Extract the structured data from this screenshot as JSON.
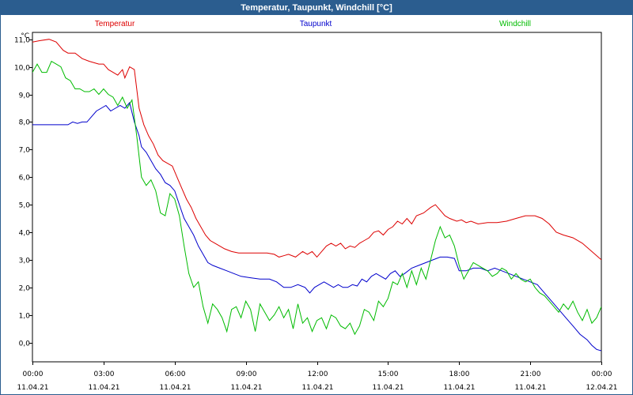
{
  "window": {
    "title": "Temperatur, Taupunkt, Windchill [°C]"
  },
  "chart_data": {
    "type": "line",
    "title": "Temperatur, Taupunkt, Windchill [°C]",
    "ylabel": "°C",
    "xlabel": "",
    "ylim": [
      -0.7,
      11.25
    ],
    "xlim": [
      0,
      24
    ],
    "grid": true,
    "yticks": [
      "0,0",
      "1,0",
      "2,0",
      "3,0",
      "4,0",
      "5,0",
      "6,0",
      "7,0",
      "8,0",
      "9,0",
      "10,0",
      "11,0"
    ],
    "ytick_values": [
      0,
      1,
      2,
      3,
      4,
      5,
      6,
      7,
      8,
      9,
      10,
      11
    ],
    "xtick_values": [
      0,
      3,
      6,
      9,
      12,
      15,
      18,
      21,
      24
    ],
    "xticks_time": [
      "00:00",
      "03:00",
      "06:00",
      "09:00",
      "12:00",
      "15:00",
      "18:00",
      "21:00",
      "00:00"
    ],
    "xticks_date": [
      "11.04.21",
      "11.04.21",
      "11.04.21",
      "11.04.21",
      "11.04.21",
      "11.04.21",
      "11.04.21",
      "11.04.21",
      "12.04.21"
    ],
    "series": [
      {
        "name": "Temperatur",
        "color": "#dd0000",
        "points": [
          [
            0,
            10.9
          ],
          [
            0.3,
            10.95
          ],
          [
            0.7,
            11.0
          ],
          [
            1,
            10.9
          ],
          [
            1.3,
            10.6
          ],
          [
            1.5,
            10.5
          ],
          [
            1.8,
            10.5
          ],
          [
            2.1,
            10.3
          ],
          [
            2.4,
            10.2
          ],
          [
            2.8,
            10.1
          ],
          [
            3.0,
            10.1
          ],
          [
            3.2,
            9.9
          ],
          [
            3.4,
            9.8
          ],
          [
            3.6,
            9.7
          ],
          [
            3.8,
            9.9
          ],
          [
            3.9,
            9.6
          ],
          [
            4.1,
            10.0
          ],
          [
            4.3,
            9.9
          ],
          [
            4.5,
            8.5
          ],
          [
            4.7,
            7.9
          ],
          [
            4.9,
            7.5
          ],
          [
            5.1,
            7.2
          ],
          [
            5.3,
            6.8
          ],
          [
            5.5,
            6.6
          ],
          [
            5.7,
            6.5
          ],
          [
            5.9,
            6.4
          ],
          [
            6.1,
            6.0
          ],
          [
            6.3,
            5.6
          ],
          [
            6.5,
            5.2
          ],
          [
            6.7,
            4.9
          ],
          [
            6.9,
            4.5
          ],
          [
            7.1,
            4.2
          ],
          [
            7.3,
            3.9
          ],
          [
            7.5,
            3.7
          ],
          [
            7.7,
            3.6
          ],
          [
            7.9,
            3.5
          ],
          [
            8.1,
            3.4
          ],
          [
            8.4,
            3.3
          ],
          [
            8.7,
            3.25
          ],
          [
            9.0,
            3.25
          ],
          [
            9.5,
            3.25
          ],
          [
            9.9,
            3.25
          ],
          [
            10.2,
            3.2
          ],
          [
            10.4,
            3.1
          ],
          [
            10.6,
            3.15
          ],
          [
            10.8,
            3.2
          ],
          [
            11.1,
            3.1
          ],
          [
            11.4,
            3.3
          ],
          [
            11.6,
            3.2
          ],
          [
            11.8,
            3.3
          ],
          [
            12.0,
            3.1
          ],
          [
            12.2,
            3.3
          ],
          [
            12.4,
            3.5
          ],
          [
            12.6,
            3.6
          ],
          [
            12.8,
            3.5
          ],
          [
            13.0,
            3.6
          ],
          [
            13.2,
            3.4
          ],
          [
            13.4,
            3.5
          ],
          [
            13.6,
            3.45
          ],
          [
            13.8,
            3.6
          ],
          [
            14.0,
            3.7
          ],
          [
            14.2,
            3.8
          ],
          [
            14.4,
            4.0
          ],
          [
            14.6,
            4.05
          ],
          [
            14.8,
            3.9
          ],
          [
            15.0,
            4.1
          ],
          [
            15.2,
            4.2
          ],
          [
            15.4,
            4.4
          ],
          [
            15.6,
            4.3
          ],
          [
            15.8,
            4.5
          ],
          [
            16.0,
            4.3
          ],
          [
            16.2,
            4.6
          ],
          [
            16.5,
            4.7
          ],
          [
            16.8,
            4.9
          ],
          [
            17.0,
            5.0
          ],
          [
            17.2,
            4.8
          ],
          [
            17.4,
            4.6
          ],
          [
            17.6,
            4.5
          ],
          [
            17.9,
            4.4
          ],
          [
            18.1,
            4.45
          ],
          [
            18.3,
            4.35
          ],
          [
            18.5,
            4.4
          ],
          [
            18.8,
            4.3
          ],
          [
            19.2,
            4.35
          ],
          [
            19.6,
            4.35
          ],
          [
            20.0,
            4.4
          ],
          [
            20.4,
            4.5
          ],
          [
            20.8,
            4.6
          ],
          [
            21.2,
            4.6
          ],
          [
            21.5,
            4.5
          ],
          [
            21.8,
            4.3
          ],
          [
            22.1,
            4.0
          ],
          [
            22.4,
            3.9
          ],
          [
            22.8,
            3.8
          ],
          [
            23.2,
            3.6
          ],
          [
            23.6,
            3.3
          ],
          [
            24.0,
            3.0
          ]
        ]
      },
      {
        "name": "Taupunkt",
        "color": "#0000cc",
        "points": [
          [
            0,
            7.9
          ],
          [
            0.5,
            7.9
          ],
          [
            1.0,
            7.9
          ],
          [
            1.5,
            7.9
          ],
          [
            1.7,
            8.0
          ],
          [
            1.9,
            7.95
          ],
          [
            2.1,
            8.0
          ],
          [
            2.3,
            8.0
          ],
          [
            2.5,
            8.2
          ],
          [
            2.7,
            8.4
          ],
          [
            2.9,
            8.5
          ],
          [
            3.1,
            8.6
          ],
          [
            3.3,
            8.4
          ],
          [
            3.5,
            8.5
          ],
          [
            3.7,
            8.6
          ],
          [
            3.9,
            8.5
          ],
          [
            4.1,
            8.7
          ],
          [
            4.3,
            8.0
          ],
          [
            4.5,
            7.5
          ],
          [
            4.6,
            7.1
          ],
          [
            4.8,
            6.9
          ],
          [
            5.0,
            6.6
          ],
          [
            5.2,
            6.3
          ],
          [
            5.4,
            6.1
          ],
          [
            5.6,
            5.8
          ],
          [
            5.8,
            5.7
          ],
          [
            6.0,
            5.5
          ],
          [
            6.2,
            5.0
          ],
          [
            6.4,
            4.5
          ],
          [
            6.6,
            4.2
          ],
          [
            6.8,
            3.9
          ],
          [
            7.0,
            3.5
          ],
          [
            7.2,
            3.2
          ],
          [
            7.4,
            2.9
          ],
          [
            7.6,
            2.8
          ],
          [
            7.9,
            2.7
          ],
          [
            8.2,
            2.6
          ],
          [
            8.5,
            2.5
          ],
          [
            8.8,
            2.4
          ],
          [
            9.2,
            2.35
          ],
          [
            9.6,
            2.3
          ],
          [
            10.0,
            2.3
          ],
          [
            10.3,
            2.2
          ],
          [
            10.6,
            2.0
          ],
          [
            10.9,
            2.0
          ],
          [
            11.2,
            2.1
          ],
          [
            11.5,
            2.0
          ],
          [
            11.7,
            1.8
          ],
          [
            11.9,
            2.0
          ],
          [
            12.1,
            2.1
          ],
          [
            12.3,
            2.2
          ],
          [
            12.5,
            2.1
          ],
          [
            12.7,
            2.0
          ],
          [
            12.9,
            2.1
          ],
          [
            13.1,
            2.0
          ],
          [
            13.3,
            2.0
          ],
          [
            13.5,
            2.1
          ],
          [
            13.7,
            2.05
          ],
          [
            13.9,
            2.3
          ],
          [
            14.1,
            2.2
          ],
          [
            14.3,
            2.4
          ],
          [
            14.5,
            2.5
          ],
          [
            14.7,
            2.4
          ],
          [
            14.9,
            2.3
          ],
          [
            15.1,
            2.5
          ],
          [
            15.3,
            2.6
          ],
          [
            15.5,
            2.4
          ],
          [
            15.7,
            2.5
          ],
          [
            16.0,
            2.7
          ],
          [
            16.3,
            2.8
          ],
          [
            16.6,
            2.9
          ],
          [
            16.9,
            3.0
          ],
          [
            17.2,
            3.1
          ],
          [
            17.5,
            3.1
          ],
          [
            17.8,
            3.05
          ],
          [
            18.0,
            2.6
          ],
          [
            18.3,
            2.6
          ],
          [
            18.6,
            2.7
          ],
          [
            18.9,
            2.7
          ],
          [
            19.2,
            2.6
          ],
          [
            19.5,
            2.7
          ],
          [
            19.8,
            2.6
          ],
          [
            20.1,
            2.5
          ],
          [
            20.4,
            2.4
          ],
          [
            20.7,
            2.3
          ],
          [
            21.0,
            2.2
          ],
          [
            21.3,
            2.1
          ],
          [
            21.6,
            1.8
          ],
          [
            21.9,
            1.5
          ],
          [
            22.2,
            1.2
          ],
          [
            22.5,
            0.9
          ],
          [
            22.8,
            0.6
          ],
          [
            23.1,
            0.3
          ],
          [
            23.4,
            0.1
          ],
          [
            23.6,
            -0.1
          ],
          [
            23.8,
            -0.25
          ],
          [
            24.0,
            -0.3
          ]
        ]
      },
      {
        "name": "Windchill",
        "color": "#00bb00",
        "points": [
          [
            0,
            9.8
          ],
          [
            0.2,
            10.1
          ],
          [
            0.4,
            9.8
          ],
          [
            0.6,
            9.8
          ],
          [
            0.8,
            10.2
          ],
          [
            1.0,
            10.1
          ],
          [
            1.2,
            10.0
          ],
          [
            1.4,
            9.6
          ],
          [
            1.6,
            9.5
          ],
          [
            1.8,
            9.2
          ],
          [
            2.0,
            9.2
          ],
          [
            2.2,
            9.1
          ],
          [
            2.4,
            9.1
          ],
          [
            2.6,
            9.2
          ],
          [
            2.8,
            9.0
          ],
          [
            3.0,
            9.2
          ],
          [
            3.2,
            9.0
          ],
          [
            3.4,
            8.9
          ],
          [
            3.6,
            8.6
          ],
          [
            3.8,
            8.9
          ],
          [
            4.0,
            8.5
          ],
          [
            4.2,
            8.8
          ],
          [
            4.4,
            7.5
          ],
          [
            4.6,
            6.0
          ],
          [
            4.8,
            5.7
          ],
          [
            5.0,
            5.9
          ],
          [
            5.2,
            5.5
          ],
          [
            5.4,
            4.7
          ],
          [
            5.6,
            4.6
          ],
          [
            5.8,
            5.4
          ],
          [
            6.0,
            5.2
          ],
          [
            6.2,
            4.6
          ],
          [
            6.4,
            3.5
          ],
          [
            6.6,
            2.5
          ],
          [
            6.8,
            2.0
          ],
          [
            7.0,
            2.2
          ],
          [
            7.2,
            1.3
          ],
          [
            7.4,
            0.7
          ],
          [
            7.6,
            1.4
          ],
          [
            7.8,
            1.2
          ],
          [
            8.0,
            0.9
          ],
          [
            8.2,
            0.4
          ],
          [
            8.4,
            1.2
          ],
          [
            8.6,
            1.3
          ],
          [
            8.8,
            0.9
          ],
          [
            9.0,
            1.5
          ],
          [
            9.2,
            1.2
          ],
          [
            9.4,
            0.4
          ],
          [
            9.6,
            1.4
          ],
          [
            9.8,
            1.1
          ],
          [
            10.0,
            0.8
          ],
          [
            10.2,
            1.0
          ],
          [
            10.4,
            1.3
          ],
          [
            10.6,
            0.9
          ],
          [
            10.8,
            1.2
          ],
          [
            11.0,
            0.5
          ],
          [
            11.2,
            1.4
          ],
          [
            11.4,
            0.7
          ],
          [
            11.6,
            0.9
          ],
          [
            11.8,
            0.4
          ],
          [
            12.0,
            0.8
          ],
          [
            12.2,
            0.9
          ],
          [
            12.4,
            0.5
          ],
          [
            12.6,
            1.0
          ],
          [
            12.8,
            0.9
          ],
          [
            13.0,
            0.6
          ],
          [
            13.2,
            0.5
          ],
          [
            13.4,
            0.7
          ],
          [
            13.6,
            0.3
          ],
          [
            13.8,
            0.6
          ],
          [
            14.0,
            1.2
          ],
          [
            14.2,
            1.1
          ],
          [
            14.4,
            0.8
          ],
          [
            14.6,
            1.5
          ],
          [
            14.8,
            1.3
          ],
          [
            15.0,
            1.6
          ],
          [
            15.2,
            2.2
          ],
          [
            15.4,
            2.1
          ],
          [
            15.6,
            2.5
          ],
          [
            15.8,
            2.0
          ],
          [
            16.0,
            2.6
          ],
          [
            16.2,
            2.1
          ],
          [
            16.4,
            2.7
          ],
          [
            16.6,
            2.3
          ],
          [
            16.8,
            3.0
          ],
          [
            17.0,
            3.7
          ],
          [
            17.2,
            4.2
          ],
          [
            17.4,
            3.8
          ],
          [
            17.6,
            3.9
          ],
          [
            17.8,
            3.5
          ],
          [
            18.0,
            2.8
          ],
          [
            18.2,
            2.3
          ],
          [
            18.4,
            2.6
          ],
          [
            18.6,
            2.9
          ],
          [
            18.8,
            2.8
          ],
          [
            19.0,
            2.7
          ],
          [
            19.2,
            2.6
          ],
          [
            19.4,
            2.4
          ],
          [
            19.6,
            2.5
          ],
          [
            19.8,
            2.7
          ],
          [
            20.0,
            2.6
          ],
          [
            20.2,
            2.3
          ],
          [
            20.4,
            2.5
          ],
          [
            20.6,
            2.3
          ],
          [
            20.8,
            2.2
          ],
          [
            21.0,
            2.3
          ],
          [
            21.2,
            2.0
          ],
          [
            21.4,
            1.8
          ],
          [
            21.6,
            1.7
          ],
          [
            21.8,
            1.5
          ],
          [
            22.0,
            1.3
          ],
          [
            22.2,
            1.1
          ],
          [
            22.4,
            1.4
          ],
          [
            22.6,
            1.2
          ],
          [
            22.8,
            1.5
          ],
          [
            23.0,
            1.1
          ],
          [
            23.2,
            0.8
          ],
          [
            23.4,
            1.2
          ],
          [
            23.6,
            0.7
          ],
          [
            23.8,
            0.9
          ],
          [
            24.0,
            1.3
          ]
        ]
      }
    ]
  }
}
